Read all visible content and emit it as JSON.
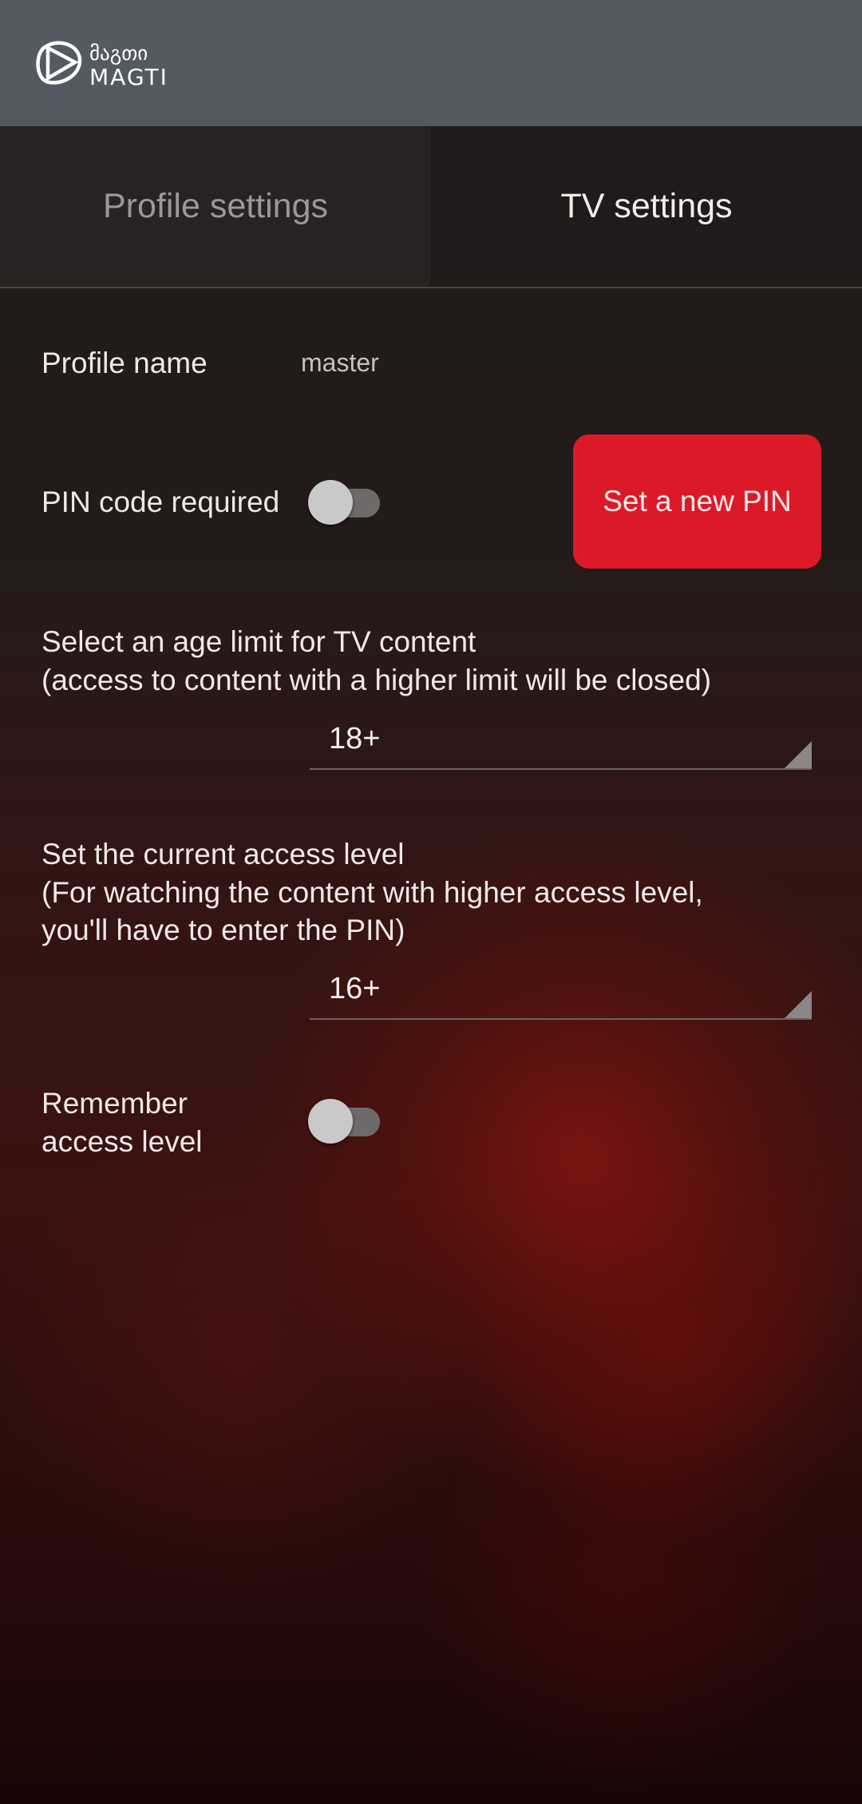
{
  "header": {
    "logo_text_georgian": "მაგთი",
    "logo_text_latin": "MAGTI"
  },
  "tabs": [
    {
      "label": "Profile settings",
      "active": false
    },
    {
      "label": "TV settings",
      "active": true
    }
  ],
  "profile": {
    "label": "Profile name",
    "value": "master"
  },
  "pin": {
    "label": "PIN code required",
    "enabled": false,
    "button": "Set a new PIN",
    "button_color": "#dc1a27"
  },
  "age_limit": {
    "line1": "Select an age limit for TV content",
    "line2": "(access to content with a higher limit will be closed)",
    "value": "18+"
  },
  "access_level": {
    "line1": "Set the current access level",
    "line2": "(For watching the content with higher access level,",
    "line3": "you'll have to enter the PIN)",
    "value": "16+"
  },
  "remember": {
    "line1": "Remember",
    "line2": "access level",
    "enabled": false
  }
}
